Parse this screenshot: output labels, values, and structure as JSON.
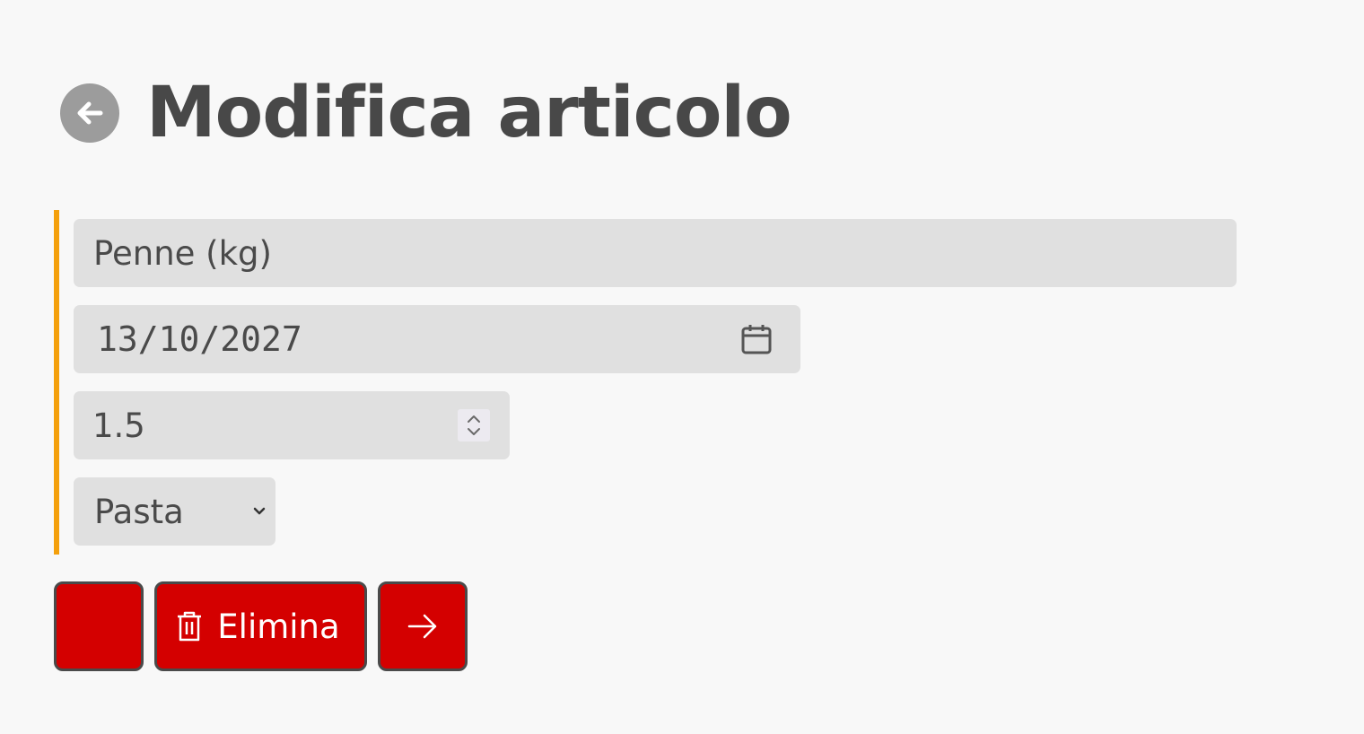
{
  "header": {
    "back_icon": "arrow-left-circle-icon",
    "title": "Modifica articolo"
  },
  "form": {
    "accent_color": "#f4a00c",
    "name_value": "Penne (kg)",
    "date_value": "13/10/2027",
    "date_icon": "calendar-icon",
    "quantity_value": "1.5",
    "quantity_icon": "stepper-icon",
    "category_value": "Pasta",
    "category_icon": "chevron-down-icon"
  },
  "actions": {
    "button_color": "#d40000",
    "delete_label": "Elimina",
    "delete_icon": "trash-icon",
    "next_icon": "arrow-right-icon"
  }
}
